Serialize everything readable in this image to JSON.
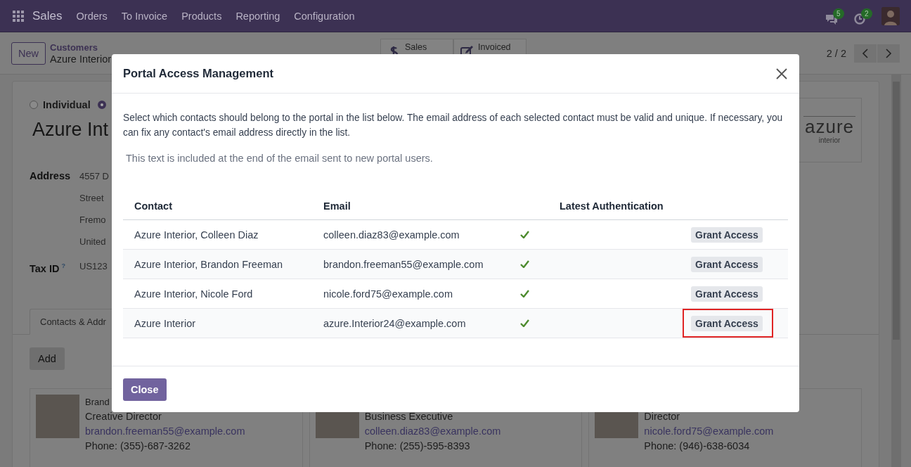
{
  "navbar": {
    "app": "Sales",
    "menu": [
      "Orders",
      "To Invoice",
      "Products",
      "Reporting",
      "Configuration"
    ],
    "messages_badge": "5",
    "activities_badge": "2"
  },
  "control_panel": {
    "new_button": "New",
    "breadcrumb_parent": "Customers",
    "breadcrumb_current": "Azure Interior",
    "stats": [
      {
        "kind": "sales",
        "label": "Sales"
      },
      {
        "kind": "invoiced",
        "label": "Invoiced"
      }
    ],
    "pager": "2 / 2"
  },
  "form": {
    "company_types": [
      {
        "label": "Individual",
        "selected": false
      },
      {
        "selected": true
      }
    ],
    "name": "Azure Int",
    "fields": [
      {
        "label": "Address",
        "lines": [
          "4557 D",
          "Street",
          "Fremo",
          "United"
        ]
      },
      {
        "label": "Tax ID",
        "help": "?",
        "lines": [
          "US123"
        ]
      }
    ],
    "logo": {
      "name": "azure",
      "tagline": "interior"
    },
    "tabs": [
      {
        "label": "Contacts & Addr",
        "selected": true
      }
    ],
    "add_button": "Add",
    "contact_cards": [
      {
        "name": "Brand",
        "title": "Creative Director",
        "email": "brandon.freeman55@example.com",
        "phone": "Phone: (355)-687-3262"
      },
      {
        "title": "Business Executive",
        "email": "colleen.diaz83@example.com",
        "phone": "Phone: (255)-595-8393"
      },
      {
        "title": "Director",
        "email": "nicole.ford75@example.com",
        "phone": "Phone: (946)-638-6034"
      }
    ]
  },
  "dialog": {
    "title": "Portal Access Management",
    "intro": "Select which contacts should belong to the portal in the list below. The email address of each selected contact must be valid and unique. If necessary, you can fix any contact's email address directly in the list.",
    "note": "This text is included at the end of the email sent to new portal users.",
    "columns": {
      "contact": "Contact",
      "email": "Email",
      "latest_authentication": "Latest Authentication"
    },
    "rows": [
      {
        "contact": "Azure Interior, Colleen Diaz",
        "email": "colleen.diaz83@example.com",
        "in_portal": true,
        "action": "Grant Access",
        "highlighted": false
      },
      {
        "contact": "Azure Interior, Brandon Freeman",
        "email": "brandon.freeman55@example.com",
        "in_portal": true,
        "action": "Grant Access",
        "highlighted": false
      },
      {
        "contact": "Azure Interior, Nicole Ford",
        "email": "nicole.ford75@example.com",
        "in_portal": true,
        "action": "Grant Access",
        "highlighted": false
      },
      {
        "contact": "Azure Interior",
        "email": "azure.Interior24@example.com",
        "in_portal": true,
        "action": "Grant Access",
        "highlighted": true
      }
    ],
    "close_button": "Close"
  }
}
